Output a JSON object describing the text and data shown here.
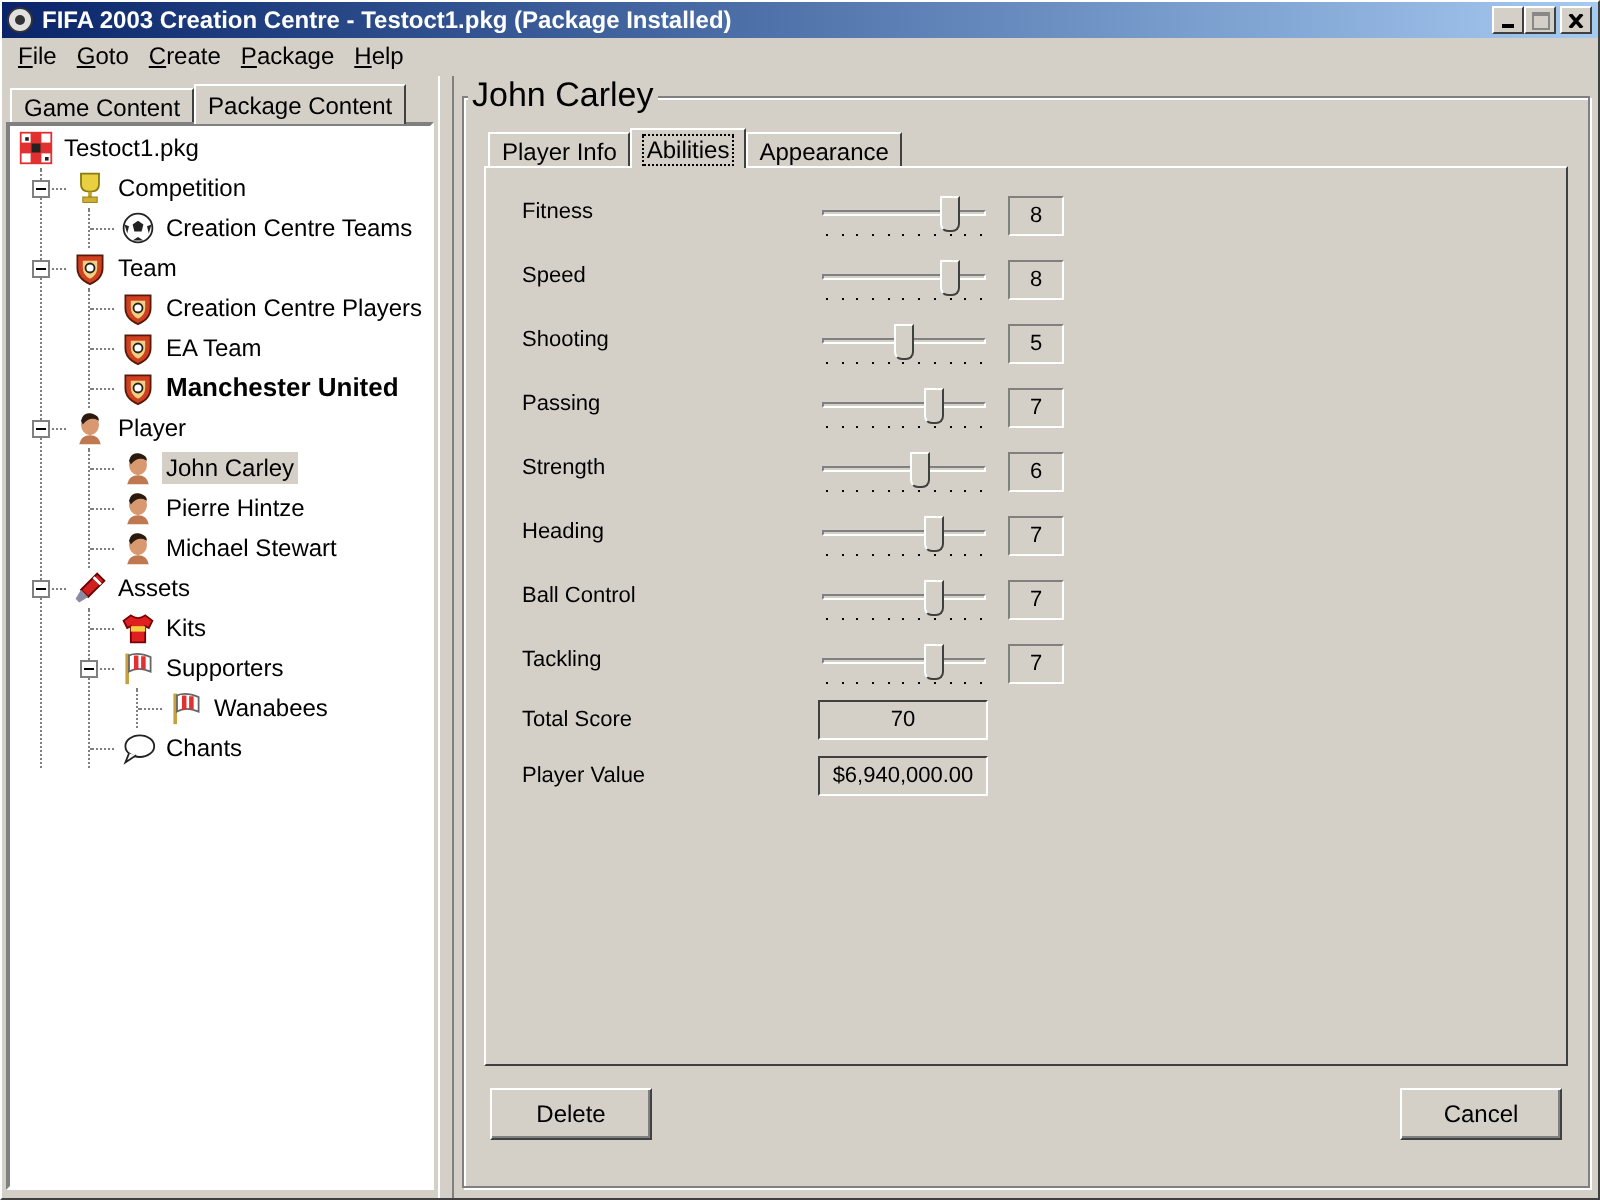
{
  "window": {
    "title": "FIFA 2003 Creation Centre - Testoct1.pkg (Package Installed)"
  },
  "menu": [
    "File",
    "Goto",
    "Create",
    "Package",
    "Help"
  ],
  "left_tabs": [
    {
      "label": "Game Content",
      "selected": false
    },
    {
      "label": "Package Content",
      "selected": true
    }
  ],
  "tree": {
    "label": "Testoct1.pkg",
    "kind": "package",
    "bold": false,
    "selected": false,
    "children": [
      {
        "label": "Competition",
        "kind": "trophy",
        "bold": false,
        "selected": false,
        "expanded": true,
        "children": [
          {
            "label": "Creation Centre Teams",
            "kind": "ball",
            "bold": false,
            "selected": false
          }
        ]
      },
      {
        "label": "Team",
        "kind": "shield",
        "bold": false,
        "selected": false,
        "expanded": true,
        "children": [
          {
            "label": "Creation Centre Players",
            "kind": "shield",
            "bold": false,
            "selected": false
          },
          {
            "label": "EA Team",
            "kind": "shield",
            "bold": false,
            "selected": false
          },
          {
            "label": "Manchester United",
            "kind": "shield",
            "bold": true,
            "selected": false
          }
        ]
      },
      {
        "label": "Player",
        "kind": "head",
        "bold": false,
        "selected": false,
        "expanded": true,
        "children": [
          {
            "label": "John Carley",
            "kind": "head",
            "bold": false,
            "selected": true
          },
          {
            "label": "Pierre Hintze",
            "kind": "head",
            "bold": false,
            "selected": false
          },
          {
            "label": "Michael Stewart",
            "kind": "head",
            "bold": false,
            "selected": false
          }
        ]
      },
      {
        "label": "Assets",
        "kind": "brush",
        "bold": false,
        "selected": false,
        "expanded": true,
        "children": [
          {
            "label": "Kits",
            "kind": "shirt",
            "bold": false,
            "selected": false
          },
          {
            "label": "Supporters",
            "kind": "flag",
            "bold": false,
            "selected": false,
            "expanded": true,
            "children": [
              {
                "label": "Wanabees",
                "kind": "flag",
                "bold": false,
                "selected": false
              }
            ]
          },
          {
            "label": "Chants",
            "kind": "bubble",
            "bold": false,
            "selected": false
          }
        ]
      }
    ]
  },
  "group_title": "John Carley",
  "tabs": [
    {
      "label": "Player Info",
      "selected": false
    },
    {
      "label": "Abilities",
      "selected": true
    },
    {
      "label": "Appearance",
      "selected": false
    }
  ],
  "abilities": [
    {
      "name": "Fitness",
      "level": 0.8,
      "reading": "8"
    },
    {
      "name": "Speed",
      "level": 0.8,
      "reading": "8"
    },
    {
      "name": "Shooting",
      "level": 0.5,
      "reading": "5"
    },
    {
      "name": "Passing",
      "level": 0.7,
      "reading": "7"
    },
    {
      "name": "Strength",
      "level": 0.6,
      "reading": "6"
    },
    {
      "name": "Heading",
      "level": 0.7,
      "reading": "7"
    },
    {
      "name": "Ball Control",
      "level": 0.7,
      "reading": "7"
    },
    {
      "name": "Tackling",
      "level": 0.7,
      "reading": "7"
    }
  ],
  "total_score": {
    "label": "Total Score",
    "value": "70"
  },
  "player_value": {
    "label": "Player Value",
    "value": "$6,940,000.00"
  },
  "buttons": [
    "Delete",
    "Cancel"
  ]
}
